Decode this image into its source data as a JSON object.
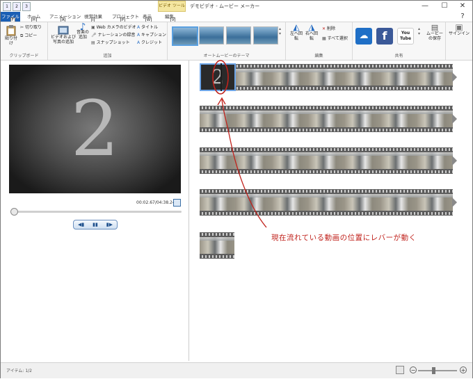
{
  "window": {
    "title": "デモビデオ - ムービー メーカー",
    "context_tab": "ビデオ ツール",
    "controls": {
      "minimize": "—",
      "maximize": "☐",
      "close": "✕",
      "help": "?"
    }
  },
  "qat": {
    "keytips": [
      "1",
      "2",
      "3"
    ]
  },
  "tabs": {
    "file": "ファイル",
    "home": "ホーム",
    "animation": "アニメーション",
    "visual_effects": "視覚効果",
    "project": "プロジェクト",
    "view": "表示",
    "edit": "編集"
  },
  "tab_keytips": {
    "file": "F",
    "home": "H",
    "animation": "A",
    "visual_effects": "I",
    "project": "P",
    "view": "W",
    "edit": "V"
  },
  "ribbon": {
    "clipboard": {
      "label": "クリップボード",
      "paste": "貼り付け",
      "cut": "切り取り",
      "copy": "コピー"
    },
    "add": {
      "label": "追加",
      "add_video_photo": "ビデオおよび写真の追加",
      "add_music": "音楽の追加",
      "webcam": "Web カメラのビデオ",
      "narration": "ナレーションの録音",
      "snapshot": "スナップショット",
      "title": "タイトル",
      "caption": "キャプション",
      "credits": "クレジット"
    },
    "automovie": {
      "label": "オートムービーのテーマ"
    },
    "editing": {
      "label": "編集",
      "rotate_left": "左へ回転",
      "rotate_right": "右へ回転",
      "remove": "削除",
      "select_all": "すべて選択"
    },
    "share": {
      "label": "共有",
      "save_movie": "ムービーの保存",
      "sign_in": "サインイン",
      "facebook": "f",
      "youtube": "You Tube"
    }
  },
  "preview": {
    "countdown_digit": "2",
    "timecode": "00:02.67/04:38.24"
  },
  "player": {
    "prev": "◀▮",
    "play_pause": "▮▮",
    "next": "▮▶"
  },
  "storyboard": {
    "clip_digit": "2",
    "annotation": "現在流れている動画の位置にレバーが動く"
  },
  "status": {
    "items": "アイテム: 1/2",
    "zoom_out": "−",
    "zoom_in": "+"
  },
  "colors": {
    "file_tab": "#1a5fb4",
    "annotation": "#c0221c",
    "context_tab": "#f4e6a0"
  }
}
